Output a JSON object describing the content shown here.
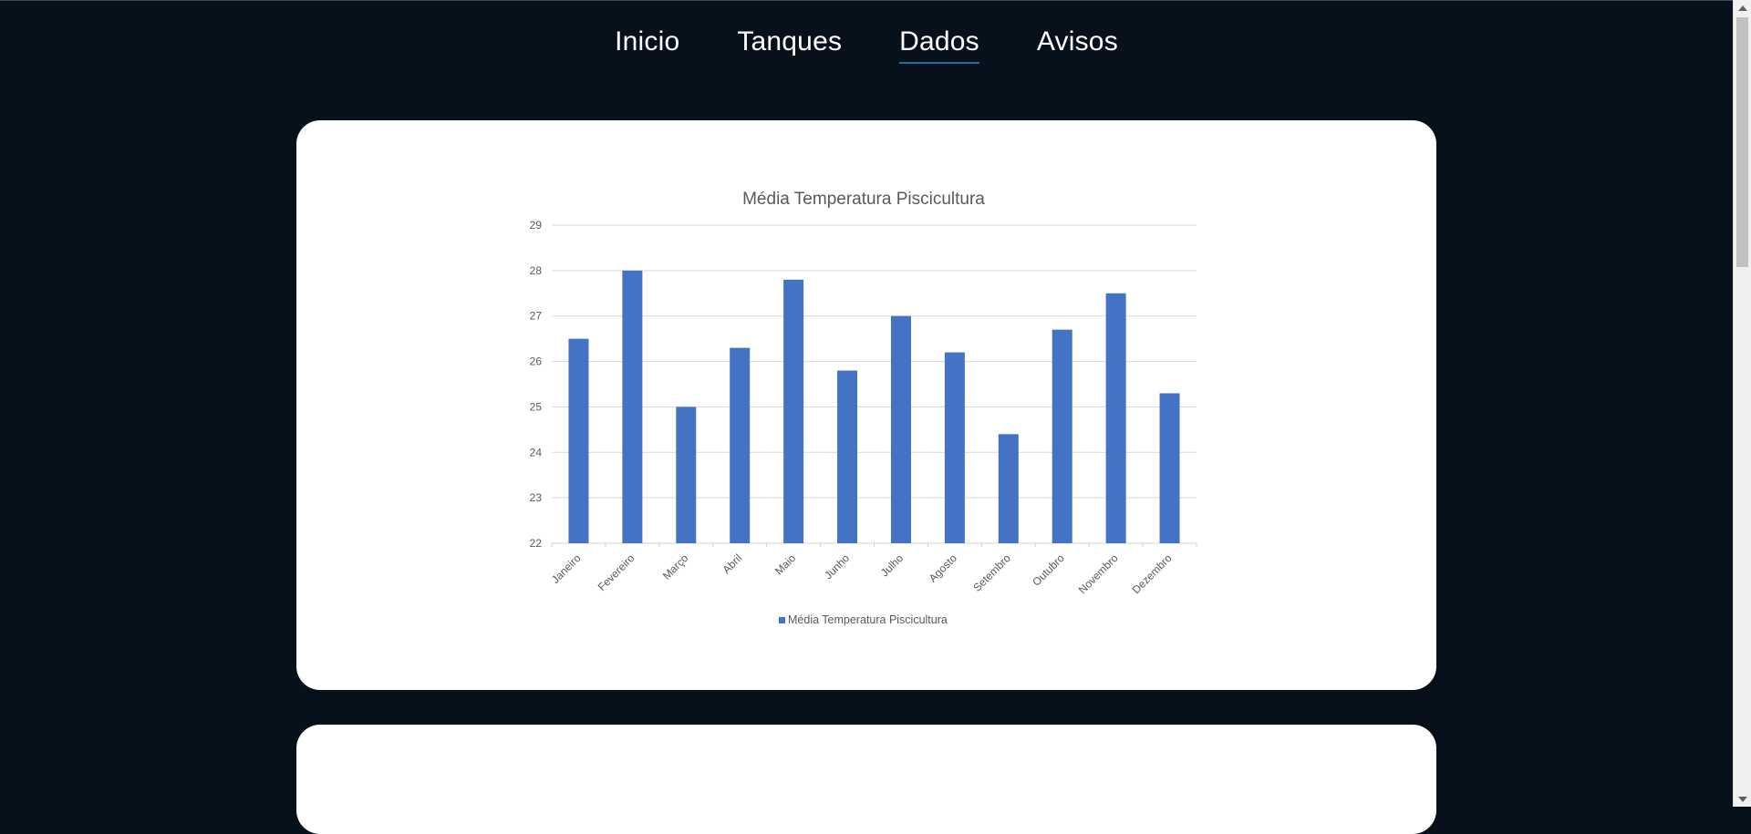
{
  "nav": {
    "items": [
      {
        "label": "Inicio",
        "active": false
      },
      {
        "label": "Tanques",
        "active": false
      },
      {
        "label": "Dados",
        "active": true
      },
      {
        "label": "Avisos",
        "active": false
      }
    ]
  },
  "colors": {
    "background": "#07111c",
    "card": "#ffffff",
    "bar": "#4472c4",
    "active_underline": "#1e6f9a"
  },
  "chart_data": {
    "type": "bar",
    "title": "Média Temperatura Piscicultura",
    "xlabel": "",
    "ylabel": "",
    "categories": [
      "Janeiro",
      "Fevereiro",
      "Março",
      "Abril",
      "Maio",
      "Junho",
      "Julho",
      "Agosto",
      "Setembro",
      "Outubro",
      "Novembro",
      "Dezembro"
    ],
    "series": [
      {
        "name": "Média Temperatura Piscicultura",
        "values": [
          26.5,
          28.0,
          25.0,
          26.3,
          27.8,
          25.8,
          27.0,
          26.2,
          24.4,
          26.7,
          27.5,
          25.3
        ]
      }
    ],
    "ylim": [
      22,
      29
    ],
    "yticks": [
      22,
      23,
      24,
      25,
      26,
      27,
      28,
      29
    ],
    "grid": true,
    "legend": "bottom"
  }
}
